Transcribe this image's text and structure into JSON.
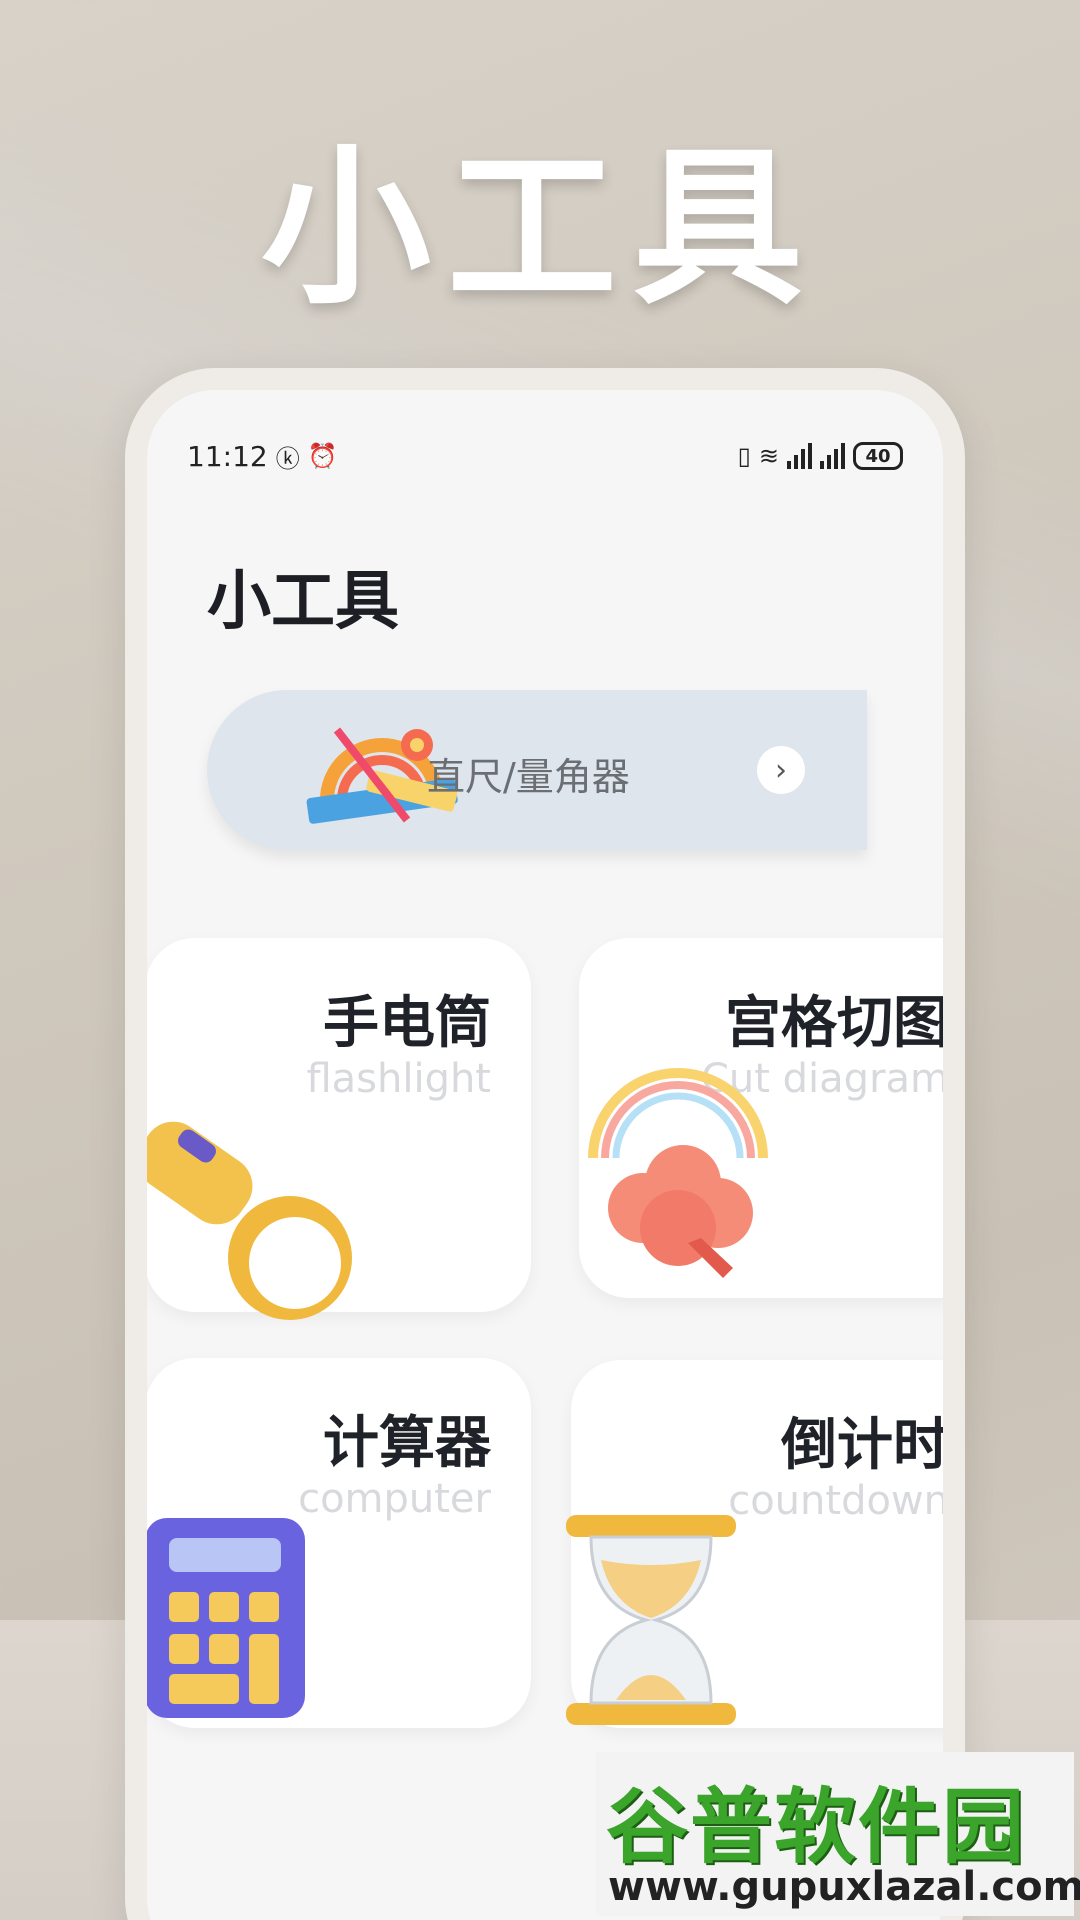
{
  "hero": {
    "title": "小工具"
  },
  "status_bar": {
    "time": "11:12",
    "battery": "40"
  },
  "app": {
    "title": "小工具"
  },
  "banner": {
    "label": "直尺/量角器",
    "arrow": "›"
  },
  "cards": [
    {
      "title": "手电筒",
      "subtitle": "flashlight",
      "icon": "flashlight-icon"
    },
    {
      "title": "宫格切图",
      "subtitle": "Cut diagram",
      "icon": "cloud-rainbow-icon"
    },
    {
      "title": "计算器",
      "subtitle": "computer",
      "icon": "calculator-icon"
    },
    {
      "title": "倒计时",
      "subtitle": "countdown",
      "icon": "hourglass-icon"
    }
  ],
  "watermark": {
    "text": "谷普软件园",
    "url": "www.gupuxlazal.com"
  },
  "colors": {
    "watermark_green": "#3aa52a",
    "banner_bg": "#dfe5ec"
  }
}
